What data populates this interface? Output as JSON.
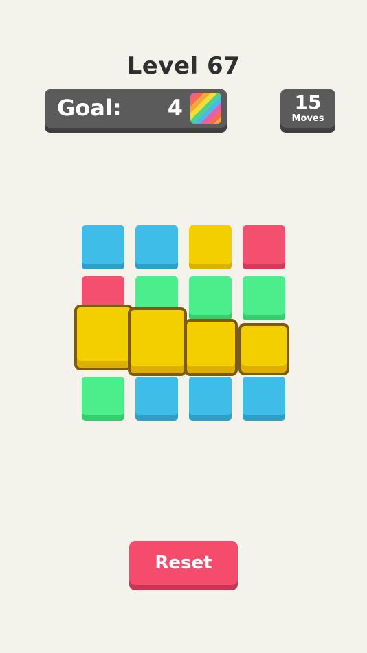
{
  "header": {
    "level_title": "Level 67"
  },
  "goal": {
    "label": "Goal:",
    "count": "4",
    "icon": "rainbow-tile-icon"
  },
  "moves": {
    "count": "15",
    "label": "Moves"
  },
  "board": {
    "rows": 4,
    "cols": 4,
    "tiles": [
      [
        "blue",
        "blue",
        "yellow",
        "red"
      ],
      [
        "red",
        "green",
        "green",
        "green"
      ],
      [
        "yellow",
        "yellow",
        "yellow",
        "yellow"
      ],
      [
        "green",
        "blue",
        "blue",
        "blue"
      ]
    ],
    "selected_row": 2
  },
  "colors": {
    "blue": "#3fbde9",
    "yellow": "#f3cf00",
    "red": "#f44f6f",
    "green": "#4ced8b",
    "panel": "#5b5b5b",
    "reset": "#f54b6c",
    "background": "#f3f2eb"
  },
  "reset_button": {
    "label": "Reset"
  }
}
